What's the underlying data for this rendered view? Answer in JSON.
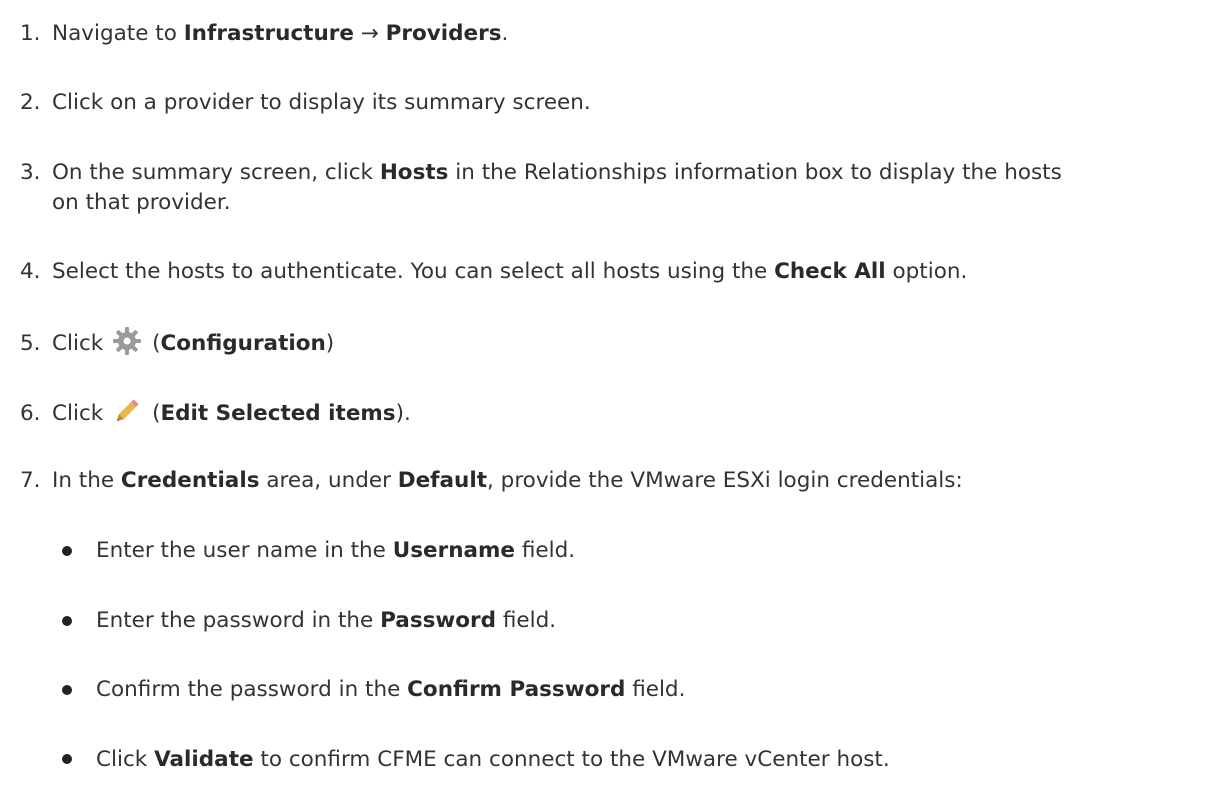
{
  "steps": [
    {
      "num": "1.",
      "parts": [
        {
          "t": "Navigate to "
        },
        {
          "t": "Infrastructure",
          "b": true
        },
        {
          "t": " → "
        },
        {
          "t": "Providers",
          "b": true
        },
        {
          "t": "."
        }
      ]
    },
    {
      "num": "2.",
      "parts": [
        {
          "t": "Click on a provider to display its summary screen."
        }
      ]
    },
    {
      "num": "3.",
      "parts": [
        {
          "t": "On the summary screen, click "
        },
        {
          "t": "Hosts",
          "b": true
        },
        {
          "t": " in the  Relationships information box to display the hosts"
        }
      ],
      "cont": "on that provider."
    },
    {
      "num": "4.",
      "parts": [
        {
          "t": "Select the hosts to authenticate. You can select all hosts using the "
        },
        {
          "t": "Check All",
          "b": true
        },
        {
          "t": " option."
        }
      ]
    },
    {
      "num": "5.",
      "parts": [
        {
          "t": "Click "
        },
        {
          "icon": "gear-icon"
        },
        {
          "t": "("
        },
        {
          "t": "Configuration",
          "b": true
        },
        {
          "t": ")"
        }
      ]
    },
    {
      "num": "6.",
      "parts": [
        {
          "t": "Click "
        },
        {
          "icon": "pencil-icon"
        },
        {
          "t": "("
        },
        {
          "t": "Edit Selected items",
          "b": true
        },
        {
          "t": ")."
        }
      ]
    },
    {
      "num": "7.",
      "parts": [
        {
          "t": "In the "
        },
        {
          "t": "Credentials",
          "b": true
        },
        {
          "t": " area, under  "
        },
        {
          "t": "Default",
          "b": true
        },
        {
          "t": ", provide the VMware ESXi login credentials:"
        }
      ]
    }
  ],
  "bullets": [
    {
      "parts": [
        {
          "t": "Enter the user name in the "
        },
        {
          "t": "Username",
          "b": true
        },
        {
          "t": " field."
        }
      ]
    },
    {
      "parts": [
        {
          "t": "Enter the password in the "
        },
        {
          "t": "Password",
          "b": true
        },
        {
          "t": " field."
        }
      ]
    },
    {
      "parts": [
        {
          "t": "Confirm the password in the "
        },
        {
          "t": "Confirm Password",
          "b": true
        },
        {
          "t": " field."
        }
      ]
    },
    {
      "parts": [
        {
          "t": "Click "
        },
        {
          "t": "Validate",
          "b": true
        },
        {
          "t": " to confirm CFME can connect to the VMware vCenter host."
        }
      ]
    }
  ],
  "colors": {
    "text": "#333333",
    "bold_text": "#2a2a2a",
    "gear_icon": "#9a9a9a",
    "pencil_body": "#e8b84a",
    "pencil_tip": "#c98a2a"
  }
}
